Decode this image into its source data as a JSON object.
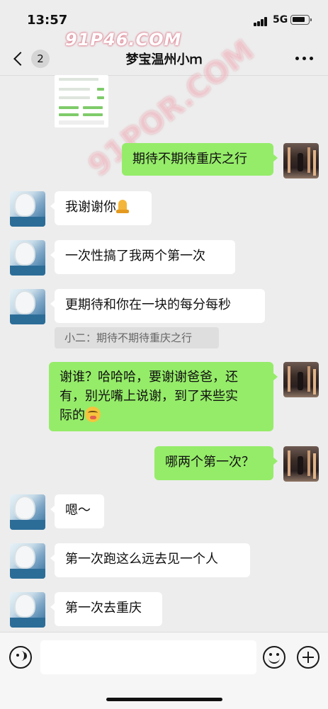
{
  "status": {
    "time": "13:57",
    "network": "5G"
  },
  "nav": {
    "back_count": "2",
    "title": "梦宝温州小ｍ",
    "more_icon": "more-dots-icon"
  },
  "watermark": {
    "text": "91P46.COM",
    "diagonal": "91POR.COM"
  },
  "messages": [
    {
      "side": "right",
      "text": "期待不期待重庆之行"
    },
    {
      "side": "left",
      "text": "我谢谢你",
      "emoji": "pray"
    },
    {
      "side": "left",
      "text": "一次性搞了我两个第一次"
    },
    {
      "side": "left",
      "text": "更期待和你在一块的每分每秒"
    },
    {
      "side": "right",
      "text_lines": [
        "谢谁？哈哈哈，要谢谢爸爸，还",
        "有，别光嘴上说谢，到了来些实",
        "际的"
      ],
      "emoji": "grimace"
    },
    {
      "side": "right",
      "text": "哪两个第一次？"
    },
    {
      "side": "left",
      "text": "嗯～"
    },
    {
      "side": "left",
      "text": "第一次跑这么远去见一个人"
    },
    {
      "side": "left",
      "text": "第一次去重庆"
    }
  ],
  "quote": {
    "text": "小二：期待不期待重庆之行"
  },
  "input": {
    "placeholder": ""
  },
  "colors": {
    "bg": "#ededed",
    "self_bubble": "#95ec69",
    "peer_bubble": "#ffffff"
  }
}
